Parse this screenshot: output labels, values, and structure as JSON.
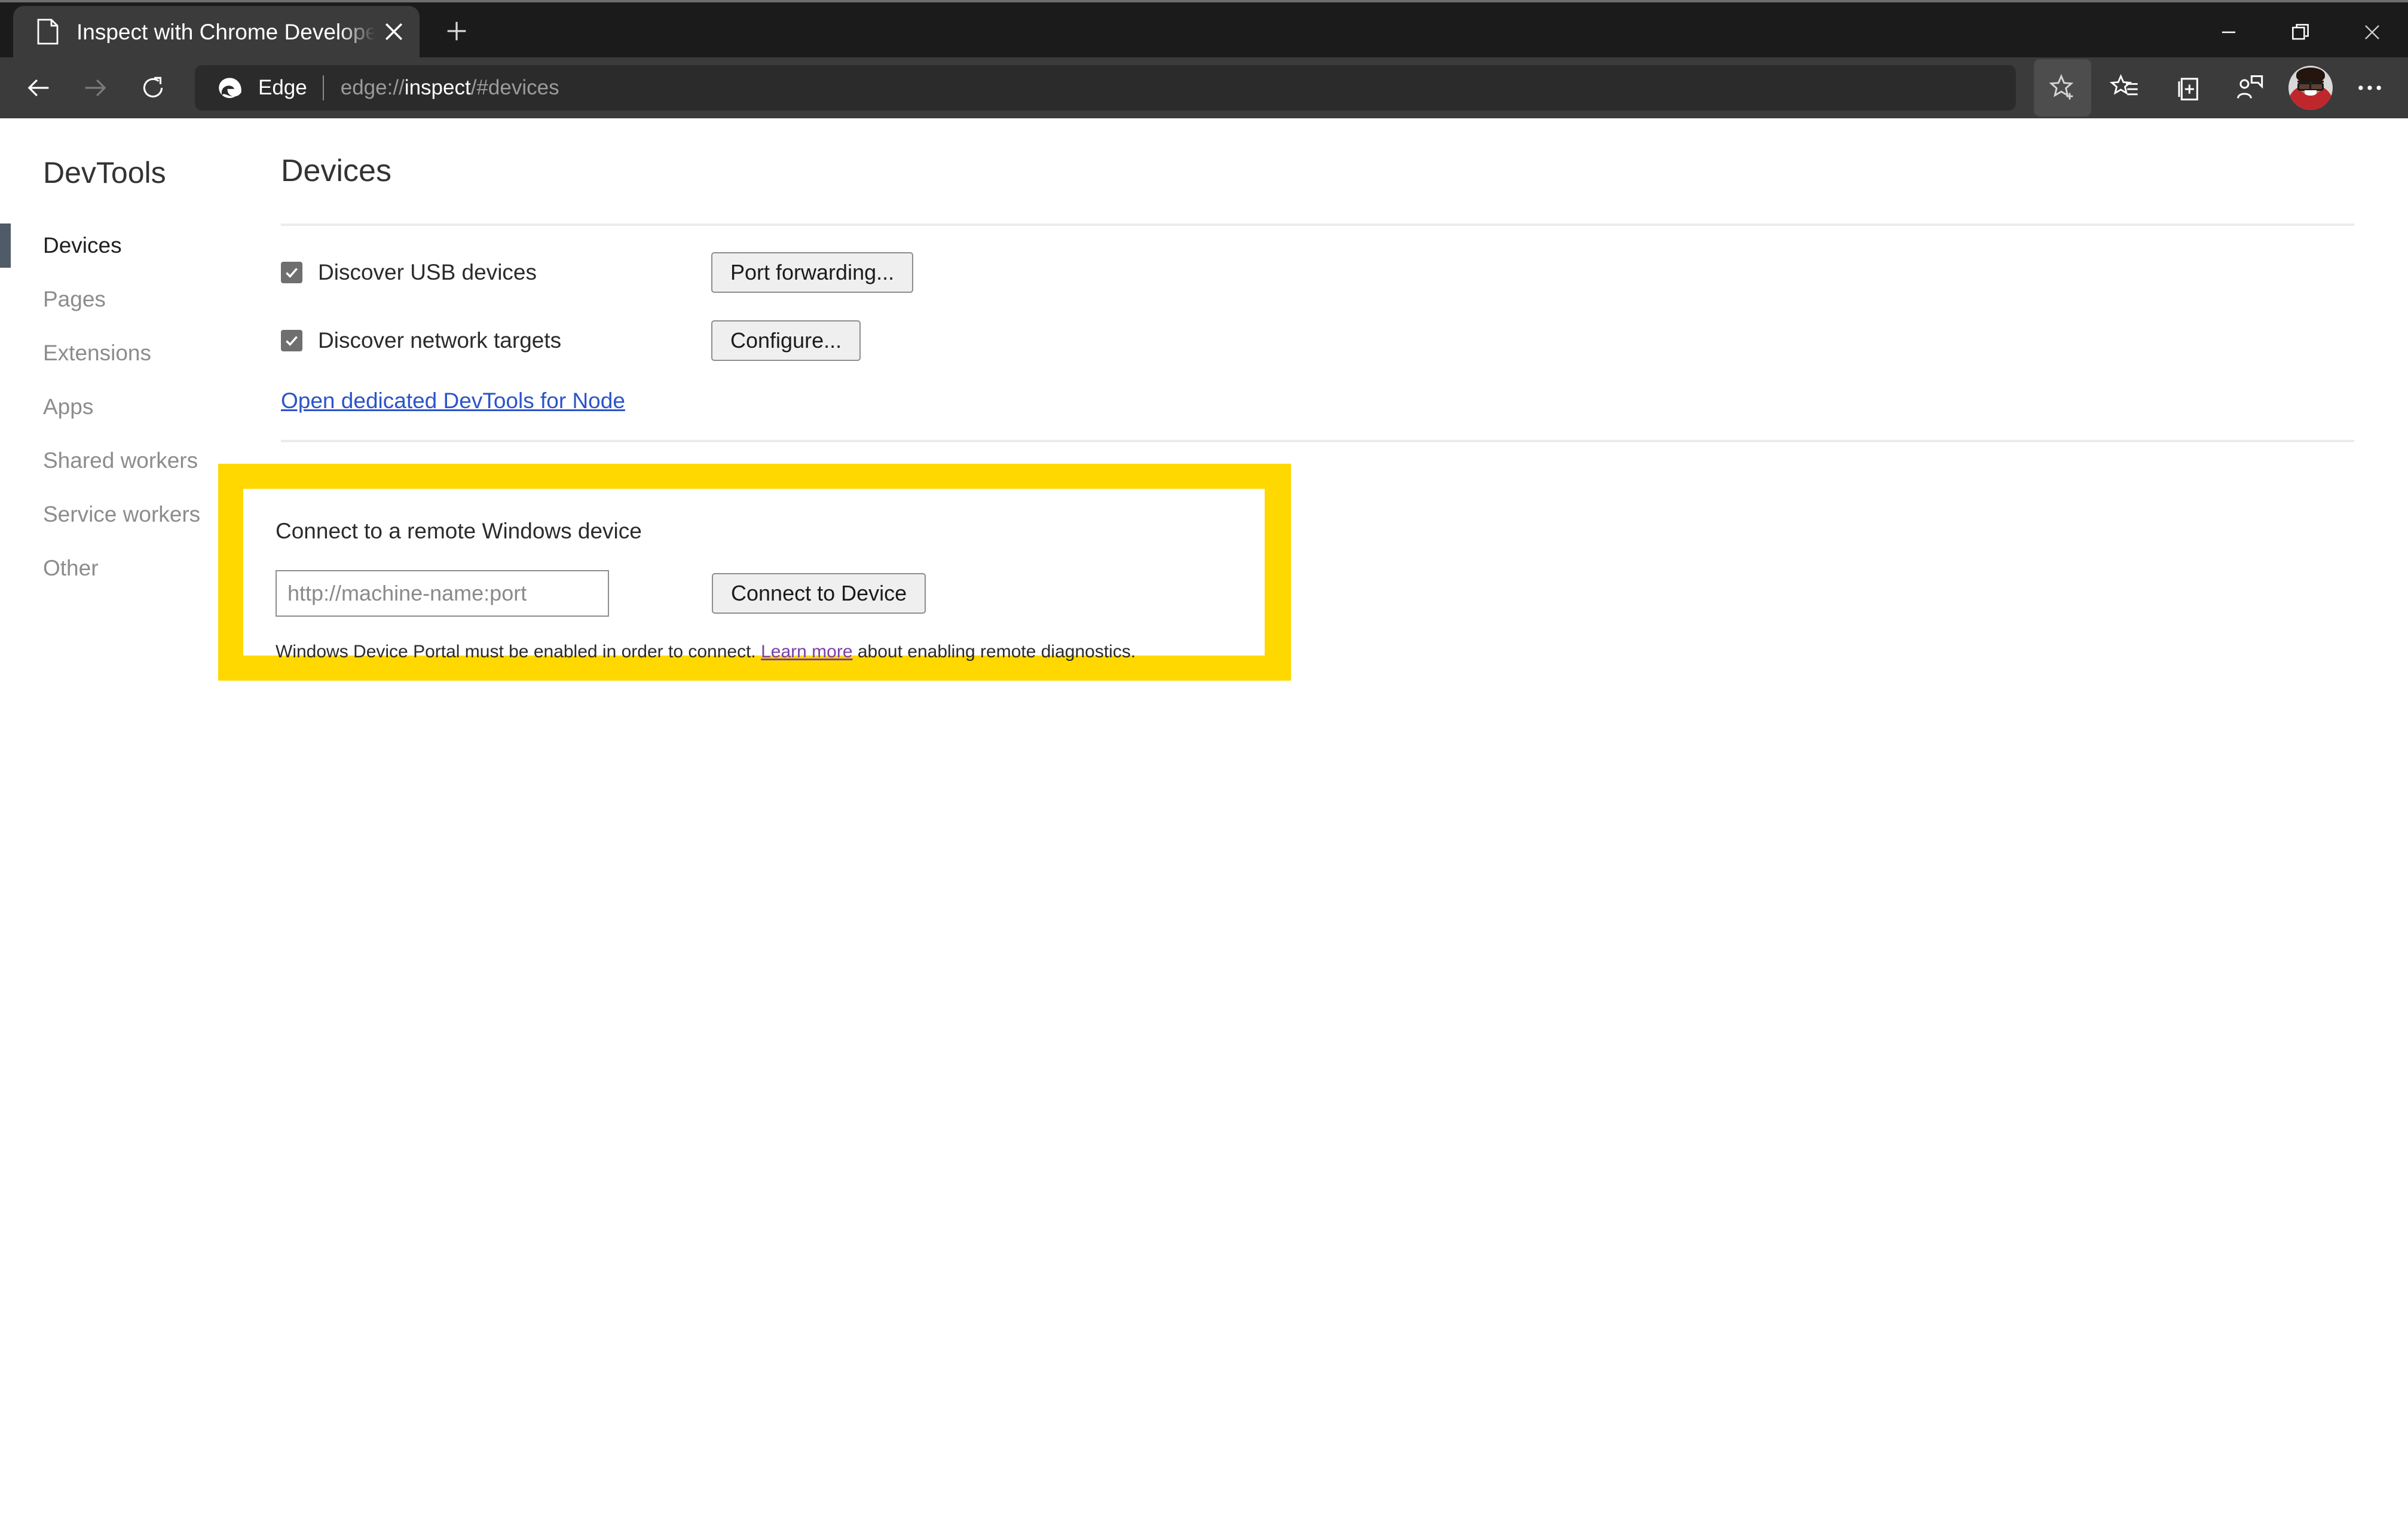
{
  "window": {
    "controls": {
      "minimize": "minimize-icon",
      "restore": "restore-icon",
      "close": "close-icon"
    }
  },
  "tabstrip": {
    "tab": {
      "favicon": "page-icon",
      "title": "Inspect with Chrome Developer T",
      "close_icon": "close-icon"
    },
    "new_tab_icon": "plus-icon"
  },
  "toolbar": {
    "back_icon": "back-arrow-icon",
    "forward_icon": "forward-arrow-icon",
    "reload_icon": "reload-icon",
    "address": {
      "brand": "Edge",
      "url_prefix": "edge://",
      "url_highlight": "inspect",
      "url_suffix": "/#devices",
      "full_url": "edge://inspect/#devices"
    },
    "icons": [
      {
        "name": "favorite-star-icon",
        "highlighted": true
      },
      {
        "name": "favorites-list-icon",
        "highlighted": false
      },
      {
        "name": "collections-icon",
        "highlighted": false
      },
      {
        "name": "profile-share-icon",
        "highlighted": false
      }
    ],
    "avatar": "user-avatar",
    "settings_icon": "more-options-icon"
  },
  "sidebar": {
    "title": "DevTools",
    "items": [
      {
        "label": "Devices",
        "selected": true
      },
      {
        "label": "Pages",
        "selected": false
      },
      {
        "label": "Extensions",
        "selected": false
      },
      {
        "label": "Apps",
        "selected": false
      },
      {
        "label": "Shared workers",
        "selected": false
      },
      {
        "label": "Service workers",
        "selected": false
      },
      {
        "label": "Other",
        "selected": false
      }
    ]
  },
  "main": {
    "title": "Devices",
    "rows": [
      {
        "checkbox_label": "Discover USB devices",
        "checked": true,
        "button_label": "Port forwarding..."
      },
      {
        "checkbox_label": "Discover network targets",
        "checked": true,
        "button_label": "Configure..."
      }
    ],
    "node_link": "Open dedicated DevTools for Node"
  },
  "callout": {
    "heading": "Connect to a remote Windows device",
    "input_placeholder": "http://machine-name:port",
    "input_value": "",
    "connect_button": "Connect to Device",
    "note_before": "Windows Device Portal must be enabled in order to connect. ",
    "note_link": "Learn more",
    "note_after": " about enabling remote diagnostics.",
    "highlight_color": "#ffd800",
    "link_color": "#7a3fa8"
  }
}
